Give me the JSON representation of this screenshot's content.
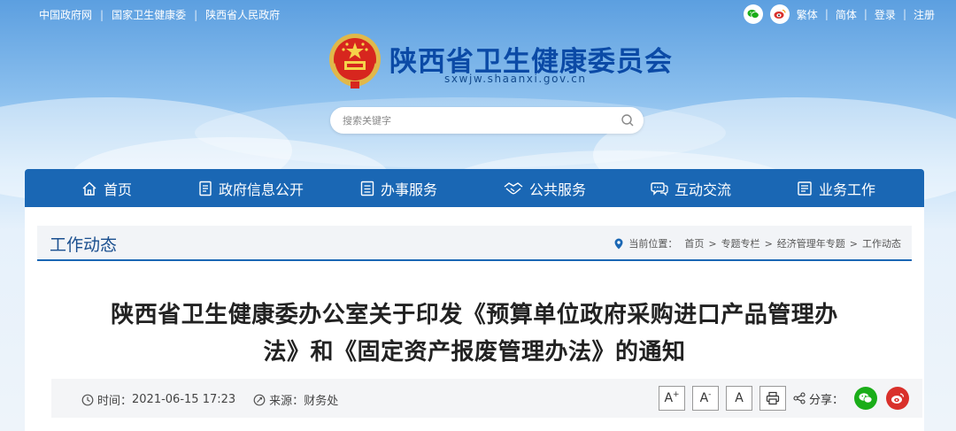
{
  "colors": {
    "brand_blue": "#1a67b4",
    "title_blue": "#0b4aa6",
    "wechat_green": "#1aad19",
    "weibo_red": "#d9302b"
  },
  "topbar": {
    "links": [
      "中国政府网",
      "国家卫生健康委",
      "陕西省人民政府"
    ],
    "right_links": [
      "繁体",
      "简体",
      "登录",
      "注册"
    ],
    "icons": [
      "wechat-icon",
      "weibo-icon"
    ]
  },
  "header": {
    "site_name": "陕西省卫生健康委员会",
    "domain": "sxwjw.shaanxi.gov.cn",
    "logo": "national-emblem"
  },
  "search": {
    "placeholder": "搜索关键字",
    "icon": "search-icon"
  },
  "nav": {
    "items": [
      {
        "label": "首页",
        "icon": "home-icon"
      },
      {
        "label": "政府信息公开",
        "icon": "document-icon"
      },
      {
        "label": "办事服务",
        "icon": "form-icon"
      },
      {
        "label": "公共服务",
        "icon": "handshake-icon"
      },
      {
        "label": "互动交流",
        "icon": "chat-icon"
      },
      {
        "label": "业务工作",
        "icon": "briefcase-icon"
      }
    ]
  },
  "section": {
    "title": "工作动态",
    "breadcrumb_label": "当前位置：",
    "breadcrumb": [
      "首页",
      "专题专栏",
      "经济管理年专题",
      "工作动态"
    ]
  },
  "article": {
    "title_line1": "陕西省卫生健康委办公室关于印发《预算单位政府采购进口产品管理办",
    "title_line2": "法》和《固定资产报废管理办法》的通知",
    "time_label": "时间：",
    "time": "2021-06-15 17:23",
    "source_label": "来源：",
    "source": "财务处",
    "font_buttons": [
      "A",
      "A",
      "A"
    ],
    "share_label": "分享："
  }
}
